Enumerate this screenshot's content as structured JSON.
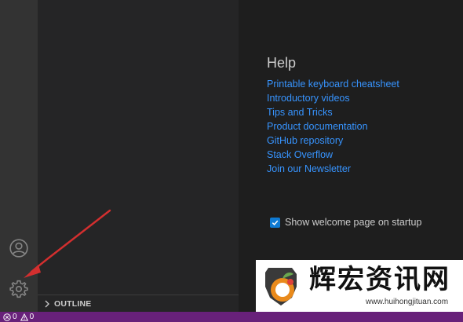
{
  "activity_bar": {
    "icons": [
      "account-icon",
      "gear-icon"
    ]
  },
  "side_bar": {
    "outline_label": "OUTLINE"
  },
  "welcome": {
    "help_title": "Help",
    "help_links": [
      "Printable keyboard cheatsheet",
      "Introductory videos",
      "Tips and Tricks",
      "Product documentation",
      "GitHub repository",
      "Stack Overflow",
      "Join our Newsletter"
    ],
    "show_on_startup_label": "Show welcome page on startup",
    "show_on_startup_checked": true
  },
  "status_bar": {
    "errors": "0",
    "warnings": "0",
    "background": "#68217a"
  },
  "watermark": {
    "text": "辉宏资讯网",
    "url": "www.huihongjituan.com"
  },
  "colors": {
    "link": "#3794ff",
    "annotation_arrow": "#d32f2f"
  }
}
